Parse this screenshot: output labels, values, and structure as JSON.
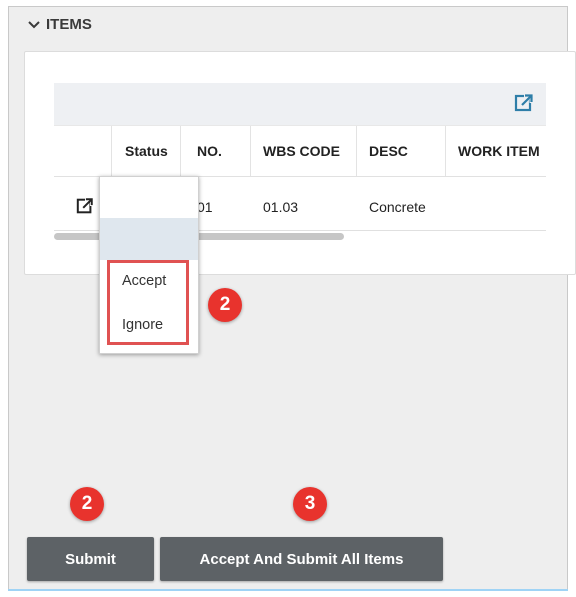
{
  "section": {
    "title": "ITEMS",
    "toggle_icon": "chevron-down-icon"
  },
  "table": {
    "columns": [
      "",
      "Status",
      "NO.",
      "WBS CODE",
      "DESC",
      "WORK ITEM"
    ],
    "rows": [
      {
        "status": "",
        "no": "01",
        "wbs_code": "01.03",
        "desc": "Concrete",
        "work_item": ""
      }
    ]
  },
  "status_dropdown": {
    "options": [
      "Accept",
      "Ignore"
    ]
  },
  "callouts": {
    "dropdown": "2",
    "submit": "2",
    "accept_all": "3"
  },
  "buttons": {
    "submit": "Submit",
    "accept_all": "Accept And Submit All Items"
  },
  "colors": {
    "accent": "#2e7ea8",
    "callout": "#e8332d",
    "button": "#5d6266"
  }
}
